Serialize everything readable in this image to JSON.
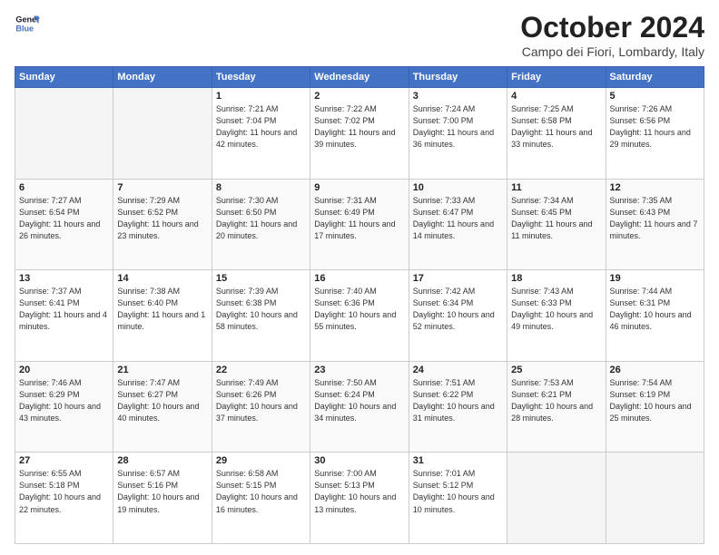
{
  "logo": {
    "line1": "General",
    "line2": "Blue"
  },
  "title": "October 2024",
  "subtitle": "Campo dei Fiori, Lombardy, Italy",
  "weekdays": [
    "Sunday",
    "Monday",
    "Tuesday",
    "Wednesday",
    "Thursday",
    "Friday",
    "Saturday"
  ],
  "weeks": [
    [
      {
        "day": "",
        "info": ""
      },
      {
        "day": "",
        "info": ""
      },
      {
        "day": "1",
        "info": "Sunrise: 7:21 AM\nSunset: 7:04 PM\nDaylight: 11 hours and 42 minutes."
      },
      {
        "day": "2",
        "info": "Sunrise: 7:22 AM\nSunset: 7:02 PM\nDaylight: 11 hours and 39 minutes."
      },
      {
        "day": "3",
        "info": "Sunrise: 7:24 AM\nSunset: 7:00 PM\nDaylight: 11 hours and 36 minutes."
      },
      {
        "day": "4",
        "info": "Sunrise: 7:25 AM\nSunset: 6:58 PM\nDaylight: 11 hours and 33 minutes."
      },
      {
        "day": "5",
        "info": "Sunrise: 7:26 AM\nSunset: 6:56 PM\nDaylight: 11 hours and 29 minutes."
      }
    ],
    [
      {
        "day": "6",
        "info": "Sunrise: 7:27 AM\nSunset: 6:54 PM\nDaylight: 11 hours and 26 minutes."
      },
      {
        "day": "7",
        "info": "Sunrise: 7:29 AM\nSunset: 6:52 PM\nDaylight: 11 hours and 23 minutes."
      },
      {
        "day": "8",
        "info": "Sunrise: 7:30 AM\nSunset: 6:50 PM\nDaylight: 11 hours and 20 minutes."
      },
      {
        "day": "9",
        "info": "Sunrise: 7:31 AM\nSunset: 6:49 PM\nDaylight: 11 hours and 17 minutes."
      },
      {
        "day": "10",
        "info": "Sunrise: 7:33 AM\nSunset: 6:47 PM\nDaylight: 11 hours and 14 minutes."
      },
      {
        "day": "11",
        "info": "Sunrise: 7:34 AM\nSunset: 6:45 PM\nDaylight: 11 hours and 11 minutes."
      },
      {
        "day": "12",
        "info": "Sunrise: 7:35 AM\nSunset: 6:43 PM\nDaylight: 11 hours and 7 minutes."
      }
    ],
    [
      {
        "day": "13",
        "info": "Sunrise: 7:37 AM\nSunset: 6:41 PM\nDaylight: 11 hours and 4 minutes."
      },
      {
        "day": "14",
        "info": "Sunrise: 7:38 AM\nSunset: 6:40 PM\nDaylight: 11 hours and 1 minute."
      },
      {
        "day": "15",
        "info": "Sunrise: 7:39 AM\nSunset: 6:38 PM\nDaylight: 10 hours and 58 minutes."
      },
      {
        "day": "16",
        "info": "Sunrise: 7:40 AM\nSunset: 6:36 PM\nDaylight: 10 hours and 55 minutes."
      },
      {
        "day": "17",
        "info": "Sunrise: 7:42 AM\nSunset: 6:34 PM\nDaylight: 10 hours and 52 minutes."
      },
      {
        "day": "18",
        "info": "Sunrise: 7:43 AM\nSunset: 6:33 PM\nDaylight: 10 hours and 49 minutes."
      },
      {
        "day": "19",
        "info": "Sunrise: 7:44 AM\nSunset: 6:31 PM\nDaylight: 10 hours and 46 minutes."
      }
    ],
    [
      {
        "day": "20",
        "info": "Sunrise: 7:46 AM\nSunset: 6:29 PM\nDaylight: 10 hours and 43 minutes."
      },
      {
        "day": "21",
        "info": "Sunrise: 7:47 AM\nSunset: 6:27 PM\nDaylight: 10 hours and 40 minutes."
      },
      {
        "day": "22",
        "info": "Sunrise: 7:49 AM\nSunset: 6:26 PM\nDaylight: 10 hours and 37 minutes."
      },
      {
        "day": "23",
        "info": "Sunrise: 7:50 AM\nSunset: 6:24 PM\nDaylight: 10 hours and 34 minutes."
      },
      {
        "day": "24",
        "info": "Sunrise: 7:51 AM\nSunset: 6:22 PM\nDaylight: 10 hours and 31 minutes."
      },
      {
        "day": "25",
        "info": "Sunrise: 7:53 AM\nSunset: 6:21 PM\nDaylight: 10 hours and 28 minutes."
      },
      {
        "day": "26",
        "info": "Sunrise: 7:54 AM\nSunset: 6:19 PM\nDaylight: 10 hours and 25 minutes."
      }
    ],
    [
      {
        "day": "27",
        "info": "Sunrise: 6:55 AM\nSunset: 5:18 PM\nDaylight: 10 hours and 22 minutes."
      },
      {
        "day": "28",
        "info": "Sunrise: 6:57 AM\nSunset: 5:16 PM\nDaylight: 10 hours and 19 minutes."
      },
      {
        "day": "29",
        "info": "Sunrise: 6:58 AM\nSunset: 5:15 PM\nDaylight: 10 hours and 16 minutes."
      },
      {
        "day": "30",
        "info": "Sunrise: 7:00 AM\nSunset: 5:13 PM\nDaylight: 10 hours and 13 minutes."
      },
      {
        "day": "31",
        "info": "Sunrise: 7:01 AM\nSunset: 5:12 PM\nDaylight: 10 hours and 10 minutes."
      },
      {
        "day": "",
        "info": ""
      },
      {
        "day": "",
        "info": ""
      }
    ]
  ]
}
